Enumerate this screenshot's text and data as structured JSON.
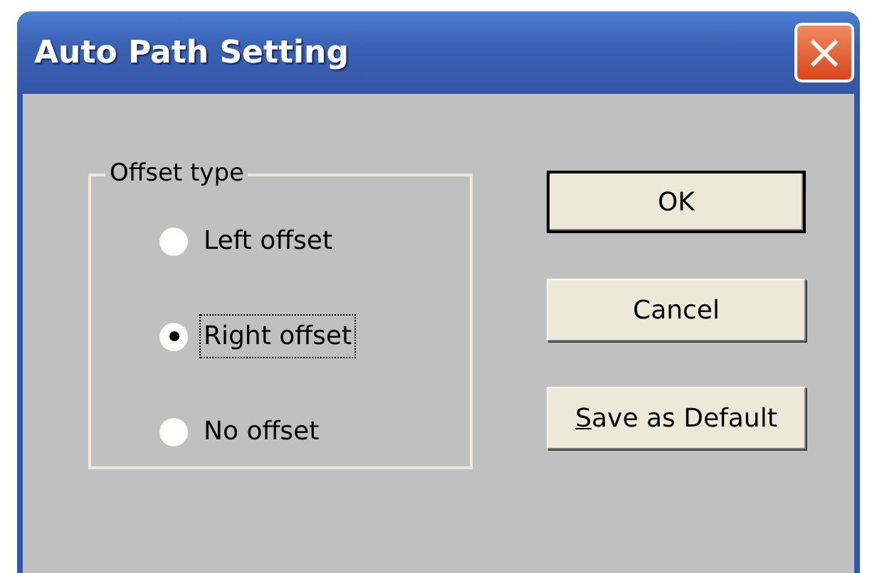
{
  "window": {
    "title": "Auto Path Setting",
    "close_icon": "×"
  },
  "offset_group": {
    "label": "Offset type",
    "options": [
      {
        "label": "Left offset",
        "selected": false,
        "focused": false
      },
      {
        "label": "Right offset",
        "selected": true,
        "focused": true
      },
      {
        "label": "No offset",
        "selected": false,
        "focused": false
      }
    ]
  },
  "buttons": [
    {
      "label": "OK",
      "default": true
    },
    {
      "label": "Cancel",
      "default": false
    },
    {
      "label": "Save as Default",
      "default": false,
      "first_letter_underlined": true
    }
  ]
}
